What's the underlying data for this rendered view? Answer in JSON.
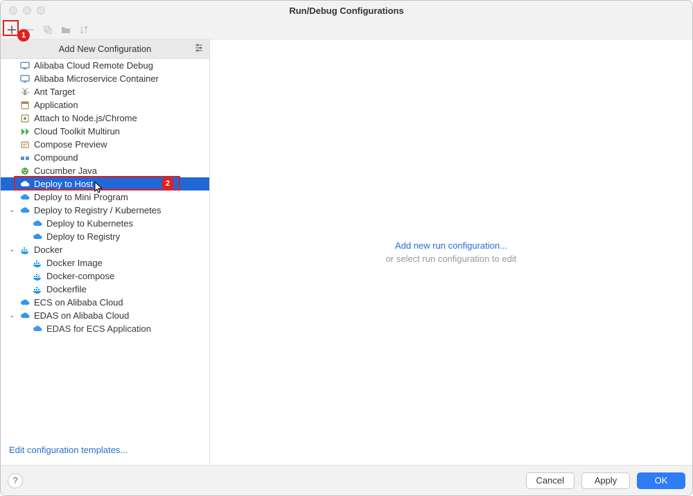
{
  "window": {
    "title": "Run/Debug Configurations"
  },
  "toolbar": {
    "add_icon": "plus-icon",
    "remove_icon": "minus-icon",
    "copy_icon": "copy-icon",
    "folder_icon": "folder-icon",
    "sort_icon": "sort-icon"
  },
  "dropdown": {
    "title": "Add New Configuration",
    "items": [
      {
        "icon": "screen",
        "label": "Alibaba Cloud Remote Debug"
      },
      {
        "icon": "screen",
        "label": "Alibaba Microservice Container"
      },
      {
        "icon": "ant",
        "label": "Ant Target"
      },
      {
        "icon": "app",
        "label": "Application"
      },
      {
        "icon": "attach",
        "label": "Attach to Node.js/Chrome"
      },
      {
        "icon": "run",
        "label": "Cloud Toolkit Multirun"
      },
      {
        "icon": "compose",
        "label": "Compose Preview"
      },
      {
        "icon": "compound",
        "label": "Compound"
      },
      {
        "icon": "cucumber",
        "label": "Cucumber Java"
      },
      {
        "icon": "cloud",
        "label": "Deploy to Host",
        "selected": true
      },
      {
        "icon": "cloud",
        "label": "Deploy to Mini Program"
      },
      {
        "icon": "cloud",
        "label": "Deploy to Registry / Kubernetes",
        "expandable": true,
        "expanded": true
      },
      {
        "icon": "cloud",
        "label": "Deploy to Kubernetes",
        "child": true
      },
      {
        "icon": "cloud",
        "label": "Deploy to Registry",
        "child": true
      },
      {
        "icon": "docker",
        "label": "Docker",
        "expandable": true,
        "expanded": true
      },
      {
        "icon": "docker",
        "label": "Docker Image",
        "child": true
      },
      {
        "icon": "docker",
        "label": "Docker-compose",
        "child": true
      },
      {
        "icon": "docker",
        "label": "Dockerfile",
        "child": true
      },
      {
        "icon": "cloud",
        "label": "ECS on Alibaba Cloud"
      },
      {
        "icon": "cloud",
        "label": "EDAS on Alibaba Cloud",
        "expandable": true,
        "expanded": true
      },
      {
        "icon": "cloud",
        "label": "EDAS for ECS Application",
        "child": true,
        "cut": true
      }
    ]
  },
  "content": {
    "link": "Add new run configuration...",
    "hint": "or select run configuration to edit"
  },
  "bottom_link": "Edit configuration templates...",
  "footer": {
    "help": "?",
    "cancel": "Cancel",
    "apply": "Apply",
    "ok": "OK"
  },
  "callouts": {
    "one": "1",
    "two": "2"
  }
}
